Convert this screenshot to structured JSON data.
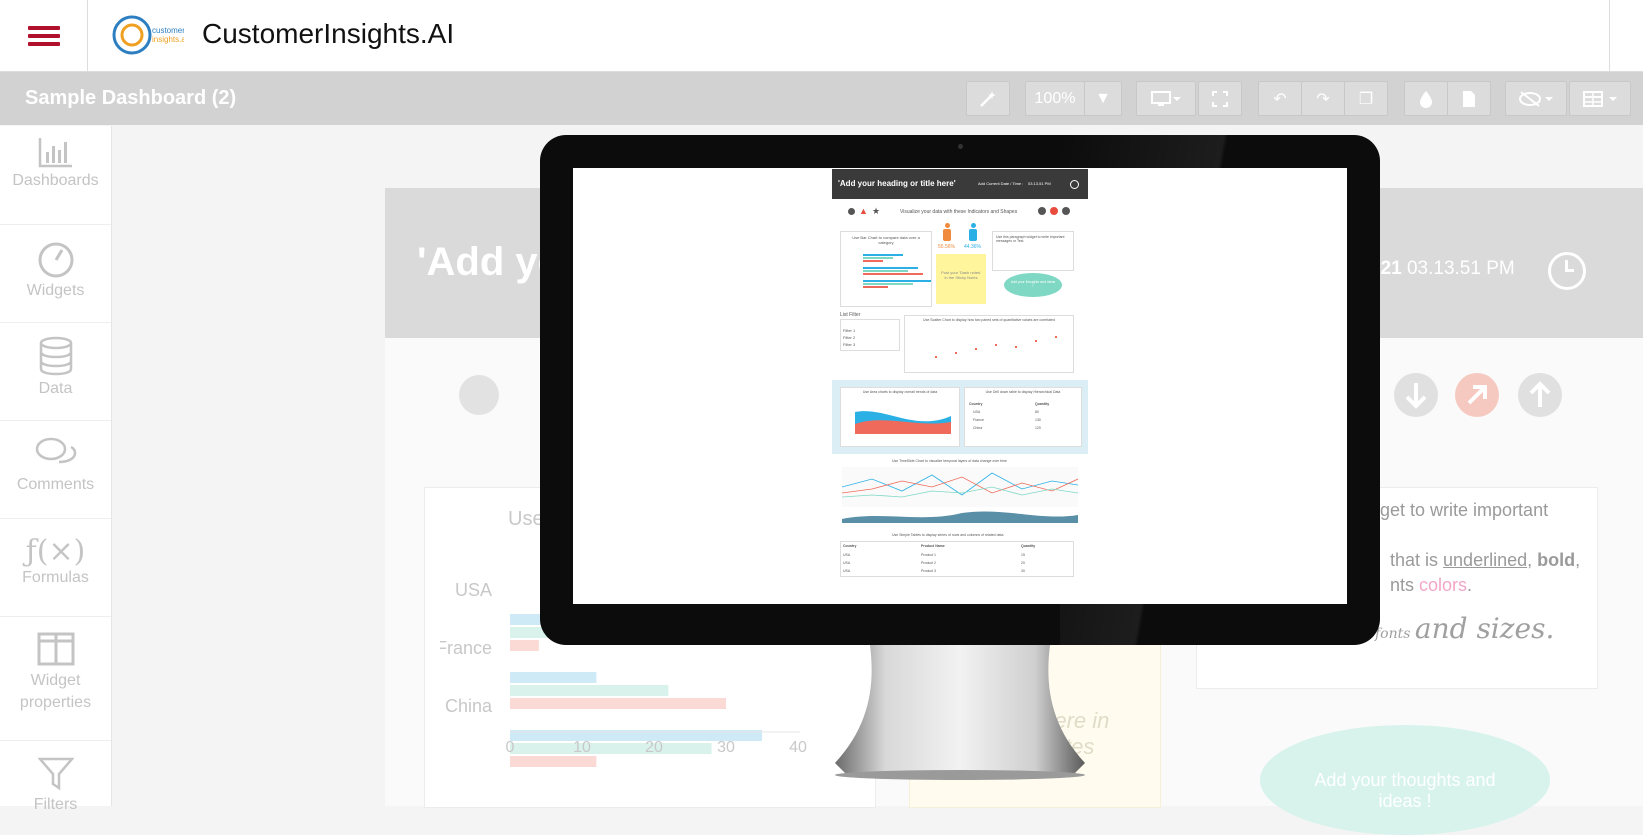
{
  "app": {
    "brand": "CustomerInsights.AI",
    "logo_text": "customer insights.ai"
  },
  "toolbar": {
    "dashboard_title": "Sample Dashboard (2)",
    "zoom": "100%"
  },
  "rail": [
    {
      "label": "Dashboards",
      "icon": "bar-chart-icon"
    },
    {
      "label": "Widgets",
      "icon": "gauge-icon"
    },
    {
      "label": "Data",
      "icon": "database-icon"
    },
    {
      "label": "Comments",
      "icon": "comments-icon"
    },
    {
      "label": "Formulas",
      "icon": "formula-icon"
    },
    {
      "label": "Widget properties",
      "icon": "columns-icon"
    },
    {
      "label": "Filters",
      "icon": "filter-icon"
    }
  ],
  "canvas": {
    "title_fragment": "'Add yo",
    "time_fragment": "021",
    "time": "03.13.51 PM",
    "use_fragment": "Use",
    "chart_categories": [
      "USA",
      "France",
      "China"
    ],
    "chart_ticks": [
      "0",
      "10",
      "20",
      "30",
      "40"
    ],
    "widget_text_1": "dget to write important",
    "widget_text_2a": "that is ",
    "widget_text_2b": "underlined",
    "widget_text_2c": ", ",
    "widget_text_2d": "bold",
    "widget_text_2e": ",",
    "widget_text_3a": "nts ",
    "widget_text_3b": "colors",
    "widget_text_3c": ".",
    "widget_text_4a": "fonts ",
    "widget_text_4b": "and sizes.",
    "sticky_text_1": "s here in",
    "sticky_text_2": "tes",
    "bubble_text_1": "Add your thoughts and",
    "bubble_text_2": "ideas !"
  },
  "chart_data": {
    "type": "bar",
    "categories": [
      "USA",
      "France",
      "China"
    ],
    "series": [
      {
        "values": [
          5,
          12,
          35
        ]
      },
      {
        "values": [
          7,
          22,
          28
        ]
      },
      {
        "values": [
          4,
          30,
          12
        ]
      }
    ],
    "xlim": [
      0,
      40
    ]
  },
  "mini": {
    "title": "'Add your heading or title here'",
    "meta": "Add Current Date / Time :",
    "meta2": "03.13.51 PM",
    "indicators_caption": "Visualize your data with these Indicators and Shapes",
    "bar_caption": "Use Bar Chart to compare data over a category",
    "pct_male": "55.56%",
    "pct_female": "44.36%",
    "sticky": "Post your 'Dash notes' in the Sticky Notes",
    "bubble": "Add your thoughts and ideas !",
    "para": "Use this paragraph widget to write important messages or Text.",
    "list_filter": "List Filter",
    "filter_items": [
      "Filter 1",
      "Filter 2",
      "Filter 3"
    ],
    "scatter_caption": "Use Scatter Chart to display how two paired sets of quantitative values are correlated",
    "area_caption": "Use Area charts to display overall trends of data",
    "drill_caption": "Use Drill down table to display Hierarchical Data",
    "drill_headers": [
      "Country",
      "Quantity"
    ],
    "drill_rows": [
      [
        "USA",
        "80"
      ],
      [
        "France",
        "130"
      ],
      [
        "China",
        "120"
      ]
    ],
    "timeline_caption": "Use TimeSlide Chart to visualize temporal layers of data change over time",
    "table_caption": "Use Simple Tables to display series of rows and columns of related data",
    "table_headers": [
      "Country",
      "Product Name",
      "Quantity"
    ],
    "table_rows": [
      [
        "USA",
        "Product 1",
        "15"
      ],
      [
        "USA",
        "Product 2",
        "20"
      ],
      [
        "USA",
        "Product 3",
        "30"
      ]
    ]
  },
  "colors": {
    "brand_red": "#b0102b",
    "blue": "#2bb0e6",
    "teal": "#7fd8c4",
    "coral": "#ef6a5a"
  }
}
